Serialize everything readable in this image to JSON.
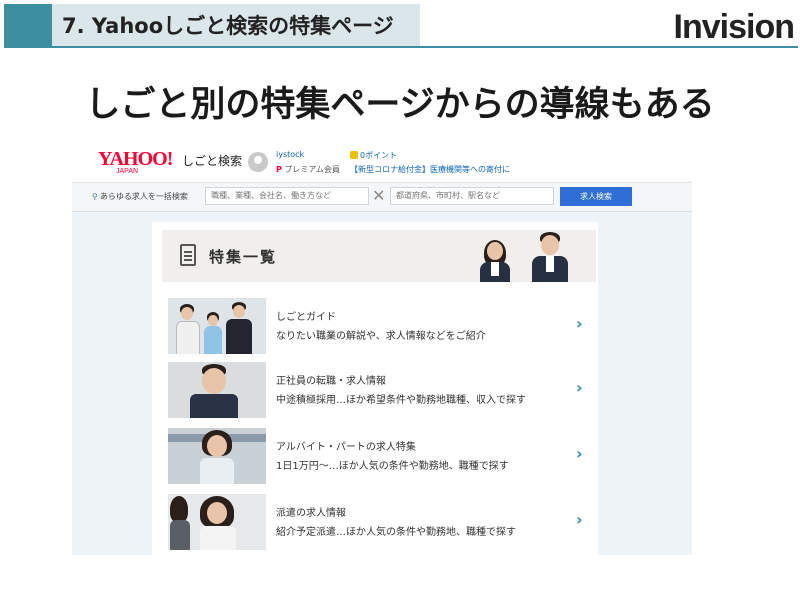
{
  "slide": {
    "header_title": "7.  Yahooしごと検索の特集ページ",
    "logo": "Invision",
    "headline": "しごと別の特集ページからの導線もある"
  },
  "yahoo": {
    "logo": "YAHOO!",
    "logo_sub": "JAPAN",
    "service": "しごと検索",
    "user": "iystock",
    "premium": "プレミアム会員",
    "points": "0ポイント",
    "notice": "【新型コロナ給付金】医療機関等への寄付に"
  },
  "search": {
    "label": "あらゆる求人を一括検索",
    "keyword_placeholder": "職種、業種、会社名、働き方など",
    "location_placeholder": "都道府県、市町村、駅名など",
    "button": "求人検索"
  },
  "feature": {
    "title": "特集一覧",
    "items": [
      {
        "title": "しごとガイド",
        "desc": "なりたい職業の解説や、求人情報などをご紹介"
      },
      {
        "title": "正社員の転職・求人情報",
        "desc": "中途積極採用…ほか希望条件や勤務地職種、収入で探す"
      },
      {
        "title": "アルバイト・パートの求人特集",
        "desc": "1日1万円～…ほか人気の条件や勤務地、職種で探す"
      },
      {
        "title": "派遣の求人情報",
        "desc": "紹介予定派遣…ほか人気の条件や勤務地、職種で探す"
      }
    ]
  },
  "colors": {
    "accent": "#3d8ea0",
    "yahoo_red": "#ff0033",
    "link": "#0b63b5",
    "button": "#2e6ed6",
    "chevron": "#2f8db0"
  },
  "icons": [
    "search-icon",
    "clear-icon",
    "document-icon",
    "chevron-right-icon",
    "avatar",
    "coin-icon"
  ]
}
